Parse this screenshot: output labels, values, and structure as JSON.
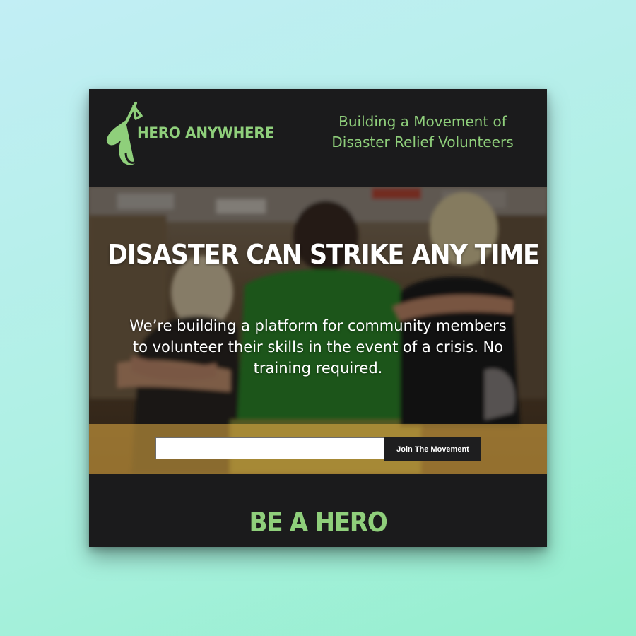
{
  "brand": {
    "name": "HERO ANYWHERE",
    "tagline": "Building a Movement of Disaster Relief Volunteers",
    "accent_color": "#8fcf7b",
    "background_color": "#1b1b1c"
  },
  "hero": {
    "headline": "DISASTER CAN STRIKE ANY TIME",
    "subtext": "We’re building a platform for community members to volunteer their skills in the event of a crisis. No training required."
  },
  "signup": {
    "email_value": "",
    "button_label": "Join The Movement"
  },
  "footer": {
    "heading": "BE A HERO"
  },
  "icons": {
    "logo": "hero-cape-logo-icon"
  }
}
